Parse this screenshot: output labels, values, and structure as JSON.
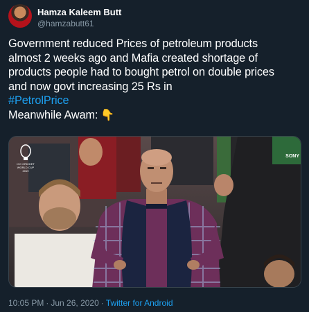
{
  "user": {
    "name": "Hamza Kaleem Butt",
    "handle": "@hamzabutt61"
  },
  "tweet": {
    "lines": [
      "Government reduced Prices of petroleum products",
      "almost 2 weeks ago and Mafia created shortage of",
      "products people had to bought petrol on double prices",
      "and now govt increasing 25 Rs in"
    ],
    "hashtag": "#PetrolPrice",
    "closing": "Meanwhile Awam:",
    "emoji": "👇"
  },
  "media": {
    "badge_lines": [
      "ICC CRICKET",
      "WORLD CUP",
      "2019"
    ],
    "corner_text": "SONY"
  },
  "footer": {
    "time": "10:05 PM",
    "separator": "·",
    "date": "Jun 26, 2020",
    "source": "Twitter for Android"
  },
  "colors": {
    "background": "#15202b",
    "link": "#1da1f2",
    "secondary_text": "#8899a6"
  }
}
